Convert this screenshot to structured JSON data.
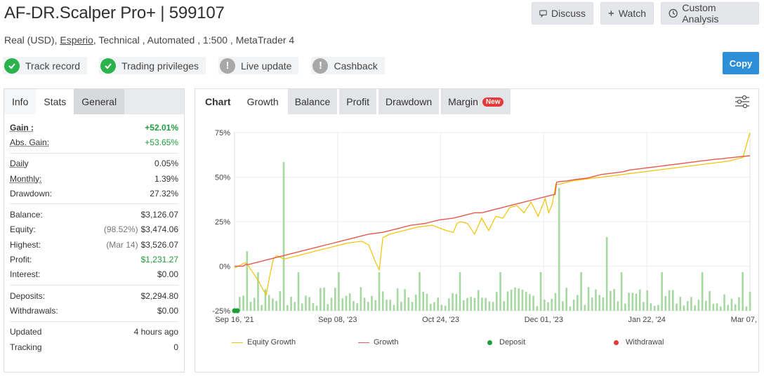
{
  "header": {
    "title": "AF-DR.Scalper Pro+ | 599107",
    "account_type": "Real (USD),",
    "broker": "Esperio",
    "details": ", Technical , Automated , 1:500 , MetaTrader 4"
  },
  "actions": {
    "discuss": "Discuss",
    "watch": "Watch",
    "custom_analysis": "Custom Analysis",
    "copy": "Copy"
  },
  "badges": [
    {
      "label": "Track record",
      "status": "ok"
    },
    {
      "label": "Trading privileges",
      "status": "ok"
    },
    {
      "label": "Live update",
      "status": "warn"
    },
    {
      "label": "Cashback",
      "status": "warn"
    }
  ],
  "stats_tabs": [
    "Info",
    "Stats",
    "General"
  ],
  "stats": {
    "gain_label": "Gain :",
    "gain": "+52.01%",
    "abs_gain_label": "Abs. Gain:",
    "abs_gain": "+53.65%",
    "daily_label": "Daily",
    "daily": "0.05%",
    "monthly_label": "Monthly:",
    "monthly": "1.39%",
    "drawdown_label": "Drawdown:",
    "drawdown": "27.32%",
    "balance_label": "Balance:",
    "balance": "$3,126.07",
    "equity_label": "Equity:",
    "equity_pct": "(98.52%)",
    "equity": "$3,474.06",
    "highest_label": "Highest:",
    "highest_date": "(Mar 14)",
    "highest": "$3,526.07",
    "profit_label": "Profit:",
    "profit": "$1,231.27",
    "interest_label": "Interest:",
    "interest": "$0.00",
    "deposits_label": "Deposits:",
    "deposits": "$2,294.80",
    "withdrawals_label": "Withdrawals:",
    "withdrawals": "$0.00",
    "updated_label": "Updated",
    "updated": "4 hours ago",
    "tracking_label": "Tracking",
    "tracking": "0"
  },
  "chart_tabs": {
    "chart": "Chart",
    "growth": "Growth",
    "balance": "Balance",
    "profit": "Profit",
    "drawdown": "Drawdown",
    "margin": "Margin",
    "new_badge": "New"
  },
  "chart_data": {
    "type": "line",
    "ylim": [
      -25,
      75
    ],
    "yticks": [
      -25,
      0,
      25,
      50,
      75
    ],
    "ytick_labels": [
      "-25%",
      "0%",
      "25%",
      "50%",
      "75%"
    ],
    "xtick_labels": [
      "Sep 16, '21",
      "Sep 08, '23",
      "Oct 24, '23",
      "Dec 01, '23",
      "Jan 22, '24",
      "Mar 07, '24"
    ],
    "grid": true,
    "legend_placement": "bottom",
    "colors": {
      "equity": "#f2c200",
      "growth": "#e55a4e",
      "deposit": "#1f9d3a",
      "withdrawal": "#e03a3a",
      "bars": "#a6d8a2"
    },
    "series": [
      {
        "name": "Growth",
        "x": [
          0,
          4,
          8,
          12,
          16,
          20,
          30,
          40,
          50,
          60,
          70,
          80,
          90,
          100,
          110,
          120,
          130,
          140,
          150,
          160,
          170,
          180,
          190,
          200,
          210,
          220,
          230,
          240,
          250,
          260,
          270,
          280,
          290,
          300,
          310,
          320,
          330,
          340,
          350,
          360,
          370,
          380,
          390,
          400,
          410,
          420,
          430,
          440,
          450,
          454,
          456,
          460,
          470,
          480,
          490,
          500,
          510,
          520,
          530,
          540,
          550,
          560,
          570,
          580,
          590,
          600,
          610,
          620,
          630,
          640,
          650,
          660,
          670,
          680,
          690,
          700,
          710,
          720,
          730
        ],
        "values": [
          0,
          0,
          0,
          0,
          1,
          1,
          2,
          3,
          4,
          5,
          6,
          7,
          8,
          9,
          10,
          11,
          12,
          13,
          14,
          15,
          16,
          17,
          18,
          18.5,
          19,
          20,
          21,
          22,
          23,
          23.5,
          24,
          25,
          26,
          26.5,
          27,
          28,
          29,
          30,
          30,
          31,
          32,
          33,
          34,
          35,
          36,
          37,
          38,
          39,
          40,
          40.3,
          47,
          47.5,
          47.8,
          48.5,
          49,
          49.5,
          50.5,
          51.5,
          52,
          52.5,
          53,
          54,
          54.5,
          55,
          55.5,
          56,
          56.5,
          57,
          57.5,
          58,
          58.5,
          59,
          59.5,
          60,
          60.3,
          60.8,
          61.2,
          61.6,
          62
        ]
      },
      {
        "name": "Equity Growth",
        "x": [
          0,
          5,
          10,
          15,
          20,
          25,
          30,
          35,
          40,
          45,
          50,
          55,
          60,
          65,
          70,
          80,
          90,
          100,
          120,
          140,
          160,
          180,
          190,
          200,
          205,
          210,
          215,
          220,
          230,
          240,
          260,
          280,
          300,
          310,
          315,
          320,
          330,
          340,
          350,
          360,
          370,
          380,
          390,
          400,
          410,
          420,
          430,
          440,
          445,
          450,
          455,
          460,
          470,
          480,
          500,
          520,
          540,
          560,
          580,
          600,
          620,
          640,
          660,
          680,
          700,
          710,
          720,
          725,
          730
        ],
        "values": [
          -1,
          0,
          1,
          2,
          0,
          -3,
          -6,
          -9,
          -13,
          -16,
          -5,
          4,
          6,
          5,
          4,
          5,
          6,
          7,
          9,
          11,
          13,
          14,
          12,
          2,
          -2,
          16,
          17,
          18,
          19,
          20,
          22,
          23,
          20,
          19,
          24,
          25,
          24,
          18,
          27,
          20,
          28,
          27,
          33,
          34,
          30,
          36,
          28,
          38,
          30,
          35,
          46,
          46,
          47,
          48,
          49,
          50,
          51,
          52,
          53,
          54,
          55,
          56,
          57,
          58,
          59,
          60,
          61,
          68,
          75
        ]
      }
    ],
    "markers": [
      {
        "type": "deposit",
        "x": 0
      },
      {
        "type": "deposit",
        "x": 4
      }
    ]
  },
  "legend": {
    "equity_growth": "Equity Growth",
    "growth": "Growth",
    "deposit": "Deposit",
    "withdrawal": "Withdrawal"
  }
}
